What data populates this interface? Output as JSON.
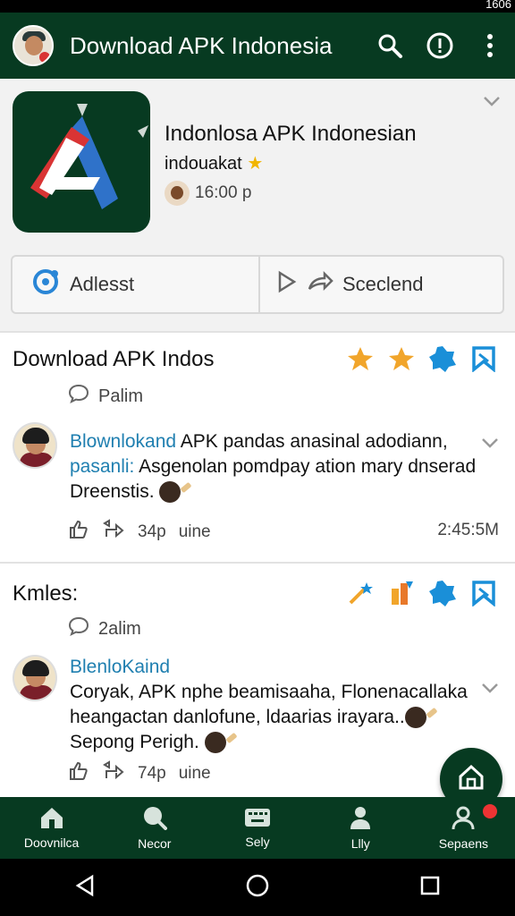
{
  "status": {
    "clock": "1606"
  },
  "appbar": {
    "title": "Download APK Indonesia",
    "icons": [
      "search-icon",
      "alert-icon",
      "more-vert-icon"
    ]
  },
  "app": {
    "name": "Indonlosa APK Indonesian",
    "subtitle": "indouakat",
    "time": "16:00 p",
    "actions": {
      "left_label": "Adlesst",
      "right_label": "Sceclend"
    }
  },
  "sections": [
    {
      "title": "Download APK Indos",
      "replies": "Palim",
      "post": {
        "user": "Blownlokand",
        "text_line1": " APK pandas anasinal adodiann,",
        "user2": "pasanli:",
        "text_line2": " Asgenolan pomdpay ation mary dnserad",
        "text_line3": "Dreenstis.",
        "count": "34p",
        "unit": "uine",
        "time": "2:45:5M"
      }
    },
    {
      "title": "Kmles:",
      "replies": "2alim",
      "post": {
        "user": "BlenloKaind",
        "text_line1": "Coryak, APK nphe beamisaaha, Flonenacallaka",
        "text_line2": "heangactan danlofune, ldaarias irayara..",
        "text_line3": "Sepong Perigh.",
        "count": "74p",
        "unit": "uine"
      }
    }
  ],
  "bottom_nav": [
    {
      "label": "Doovnilca",
      "icon": "home-icon"
    },
    {
      "label": "Necor",
      "icon": "search-icon"
    },
    {
      "label": "Sely",
      "icon": "keyboard-icon"
    },
    {
      "label": "Llly",
      "icon": "person-icon"
    },
    {
      "label": "Sepaens",
      "icon": "account-icon"
    }
  ],
  "colors": {
    "brand": "#073a21",
    "link": "#1f7fb0",
    "star": "#f1a52b",
    "blue": "#1a8fd8"
  }
}
